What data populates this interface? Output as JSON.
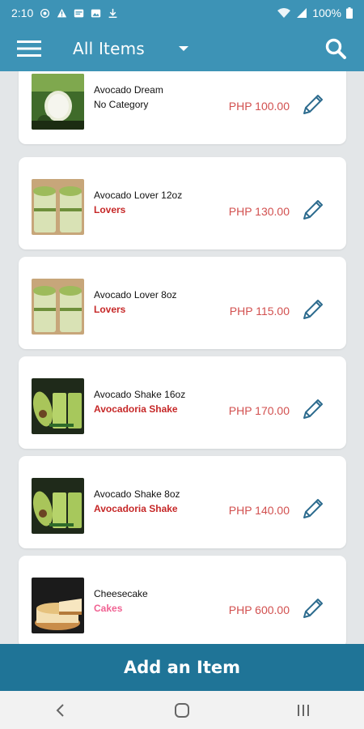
{
  "status_bar": {
    "time": "2:10",
    "battery": "100%",
    "icons": [
      "whatsapp-icon",
      "alert-icon",
      "message-icon",
      "image-icon",
      "download-icon",
      "wifi-icon",
      "signal-icon",
      "battery-icon"
    ]
  },
  "app_bar": {
    "filter_label": "All Items",
    "icons": [
      "menu-icon",
      "dropdown-caret-icon",
      "search-icon"
    ]
  },
  "items": [
    {
      "name": "Avocado Dream",
      "category": "No Category",
      "category_color": "#111111",
      "price": "PHP 100.00",
      "thumb": "avocado-dream"
    },
    {
      "name": "Avocado Lover 12oz",
      "category": "Lovers",
      "category_color": "#c62828",
      "price": "PHP 130.00",
      "thumb": "avocado-lover"
    },
    {
      "name": "Avocado Lover 8oz",
      "category": "Lovers",
      "category_color": "#c62828",
      "price": "PHP 115.00",
      "thumb": "avocado-lover"
    },
    {
      "name": "Avocado Shake 16oz",
      "category": "Avocadoria Shake",
      "category_color": "#c62828",
      "price": "PHP 170.00",
      "thumb": "avocado-shake"
    },
    {
      "name": "Avocado Shake 8oz",
      "category": "Avocadoria Shake",
      "category_color": "#c62828",
      "price": "PHP 140.00",
      "thumb": "avocado-shake"
    },
    {
      "name": "Cheesecake",
      "category": "Cakes",
      "category_color": "#f06292",
      "price": "PHP 600.00",
      "thumb": "cheesecake"
    }
  ],
  "add_button": {
    "label": "Add an Item"
  },
  "nav_bar": {
    "icons": [
      "back-icon",
      "home-icon",
      "recents-icon"
    ]
  },
  "colors": {
    "primary": "#3d93b6",
    "primary_dark": "#1f7497",
    "price": "#d2504f",
    "background": "#e3e6e8"
  }
}
